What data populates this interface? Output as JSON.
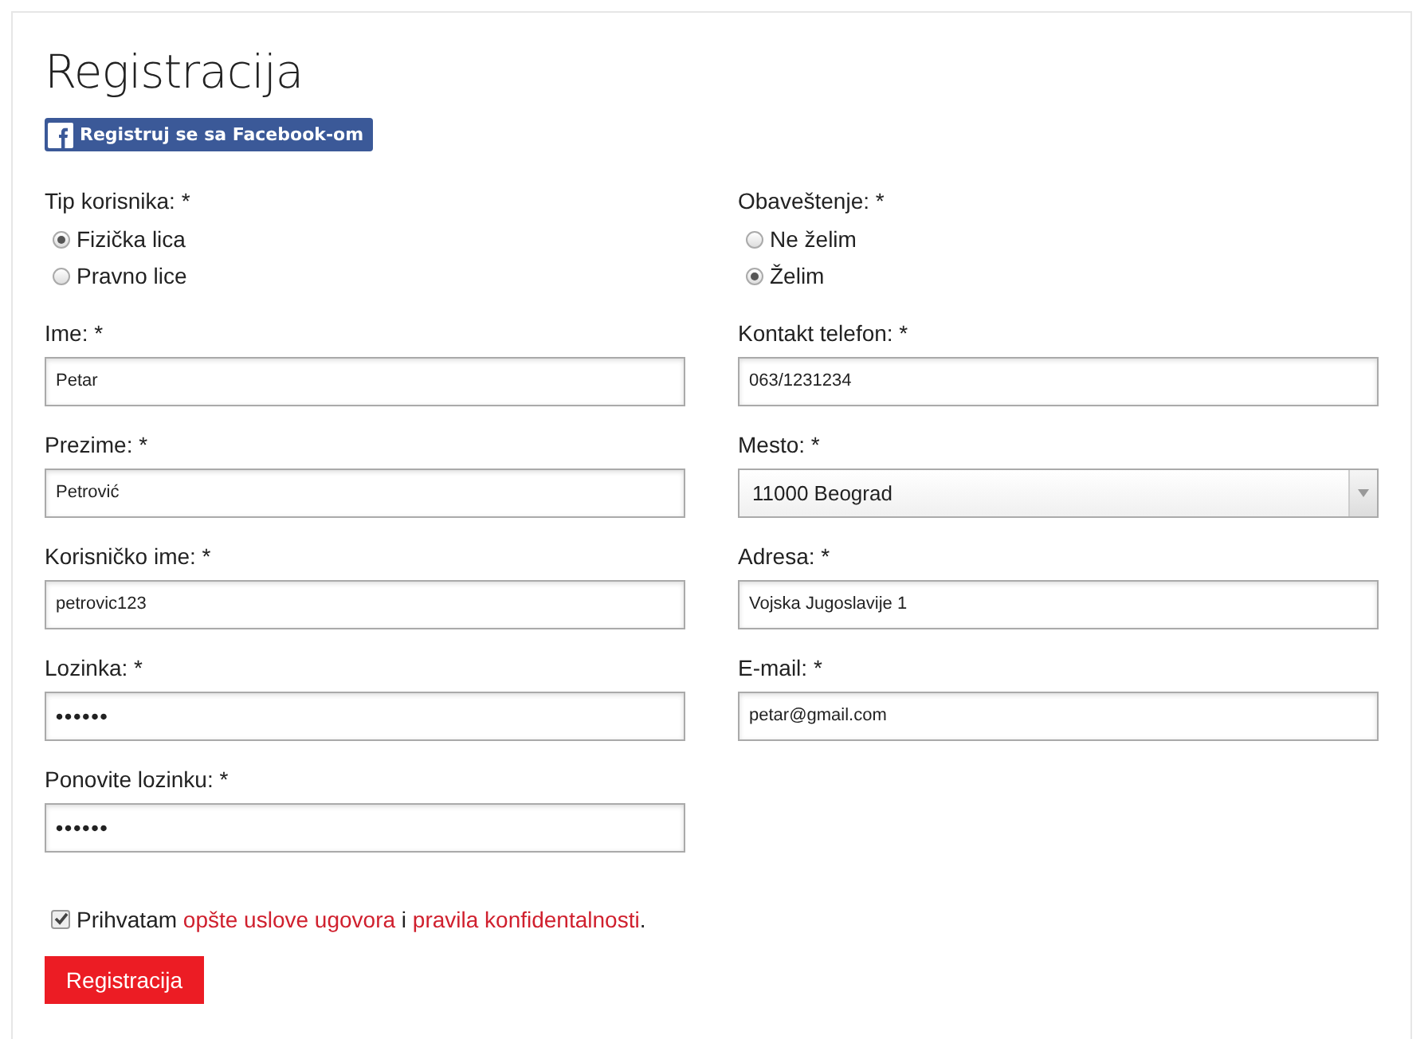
{
  "title": "Registracija",
  "facebook_button": {
    "label": "Registruj se sa Facebook-om"
  },
  "columns": [
    {
      "radio_group": {
        "label": "Tip korisnika: *",
        "options": [
          {
            "label": "Fizička lica",
            "selected": true
          },
          {
            "label": "Pravno lice",
            "selected": false
          }
        ]
      },
      "fields": [
        {
          "kind": "text",
          "label": "Ime: *",
          "value": "Petar"
        },
        {
          "kind": "text",
          "label": "Prezime: *",
          "value": "Petrović"
        },
        {
          "kind": "text",
          "label": "Korisničko ime: *",
          "value": "petrovic123"
        },
        {
          "kind": "password",
          "label": "Lozinka: *",
          "value": "••••••"
        },
        {
          "kind": "password",
          "label": "Ponovite lozinku: *",
          "value": "••••••"
        }
      ]
    },
    {
      "radio_group": {
        "label": "Obaveštenje: *",
        "options": [
          {
            "label": "Ne želim",
            "selected": false
          },
          {
            "label": "Želim",
            "selected": true
          }
        ]
      },
      "fields": [
        {
          "kind": "text",
          "label": "Kontakt telefon: *",
          "value": "063/1231234"
        },
        {
          "kind": "select",
          "label": "Mesto: *",
          "value": "11000 Beograd"
        },
        {
          "kind": "text",
          "label": "Adresa: *",
          "value": "Vojska Jugoslavije 1"
        },
        {
          "kind": "text",
          "label": "E-mail: *",
          "value": "petar@gmail.com"
        }
      ]
    }
  ],
  "agreement": {
    "checked": true,
    "parts": [
      {
        "kind": "text",
        "text": "Prihvatam "
      },
      {
        "kind": "link",
        "text": "opšte uslove ugovora"
      },
      {
        "kind": "text",
        "text": " i "
      },
      {
        "kind": "link",
        "text": "pravila konfidentalnosti"
      },
      {
        "kind": "text",
        "text": "."
      }
    ]
  },
  "submit_button": {
    "label": "Registracija"
  }
}
